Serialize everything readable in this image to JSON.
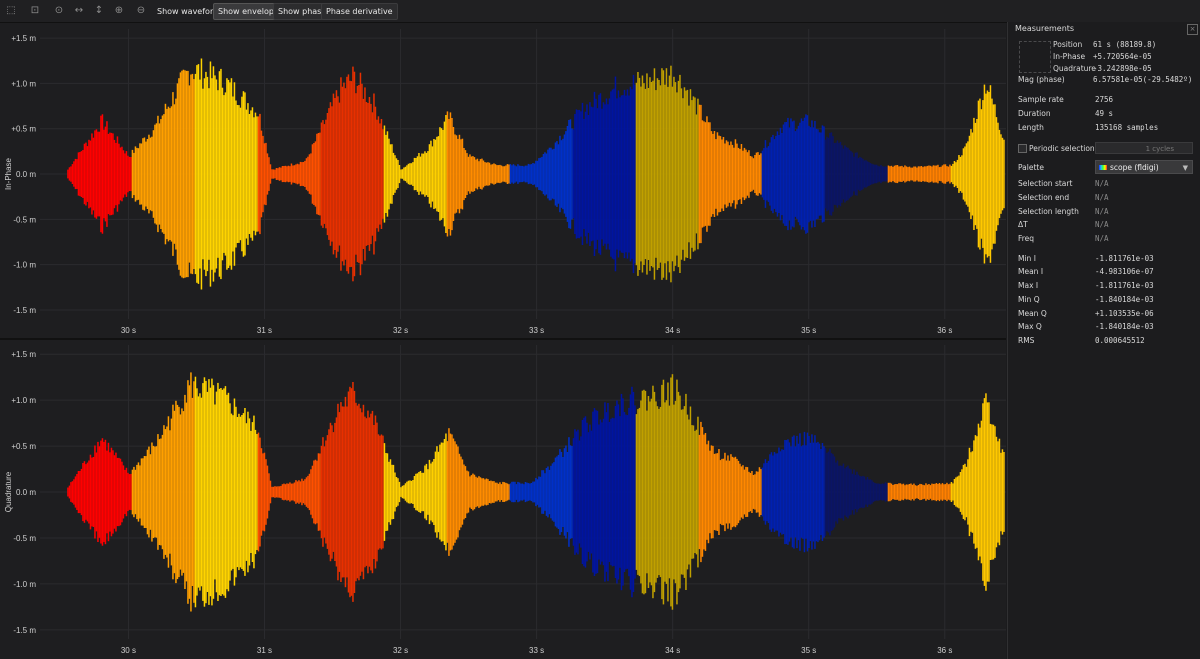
{
  "toolbar": {
    "tools": [
      "select-tool-icon",
      "zoom-box-icon",
      "zoom-fit-icon",
      "pan-horizontal-icon",
      "pan-vertical-icon",
      "zoom-in-icon",
      "zoom-out-icon"
    ],
    "show_waveform": "Show waveform",
    "show_envelope": "Show envelope",
    "show_phase": "Show phase",
    "phase_derivative": "Phase derivative"
  },
  "plots": [
    {
      "ylabel": "In-Phase"
    },
    {
      "ylabel": "Quadrature"
    }
  ],
  "axes": {
    "yticks": [
      "+1.5 m",
      "+1.0 m",
      "+0.5 m",
      "0.0 m",
      "-0.5 m",
      "-1.0 m",
      "-1.5 m"
    ],
    "xticks": [
      "30 s",
      "31 s",
      "32 s",
      "33 s",
      "34 s",
      "35 s",
      "36 s"
    ]
  },
  "chart_data": [
    {
      "type": "area",
      "title": "",
      "ylabel": "In-Phase",
      "x": [
        29.55,
        29.8,
        30.0,
        30.2,
        30.45,
        30.7,
        30.95,
        31.05,
        31.3,
        31.55,
        31.65,
        31.8,
        32.0,
        32.2,
        32.35,
        32.5,
        32.7,
        32.95,
        33.1,
        33.35,
        33.6,
        33.8,
        34.0,
        34.1,
        34.3,
        34.45,
        34.6,
        34.8,
        35.0,
        35.3,
        35.5,
        35.8,
        36.05,
        36.15,
        36.3,
        36.5
      ],
      "ylim": [
        -1.6,
        1.6
      ],
      "x_unit": "s",
      "y_unit": "m",
      "amplitude": [
        0.05,
        0.6,
        0.2,
        0.55,
        1.2,
        1.05,
        0.7,
        0.05,
        0.15,
        0.95,
        1.1,
        0.8,
        0.05,
        0.3,
        0.65,
        0.2,
        0.1,
        0.1,
        0.3,
        0.75,
        1.0,
        1.05,
        1.15,
        0.95,
        0.45,
        0.35,
        0.2,
        0.55,
        0.6,
        0.25,
        0.1,
        0.08,
        0.1,
        0.3,
        1.05,
        0.05
      ],
      "phase_colors": [
        "#ff0000",
        "#ffa000",
        "#ffd400",
        "#ff5000",
        "#e83000",
        "#ffd000",
        "#ff8c00",
        "#0030c8",
        "#0014a0",
        "#c0a000",
        "#ff8800",
        "#0020b0",
        "#0a1466",
        "#ff8000",
        "#ffc800"
      ]
    },
    {
      "type": "area",
      "title": "",
      "ylabel": "Quadrature",
      "x": [
        29.55,
        29.8,
        30.0,
        30.2,
        30.45,
        30.7,
        30.95,
        31.05,
        31.3,
        31.55,
        31.65,
        31.8,
        32.0,
        32.2,
        32.35,
        32.5,
        32.7,
        32.95,
        33.1,
        33.35,
        33.6,
        33.8,
        34.0,
        34.1,
        34.3,
        34.45,
        34.6,
        34.8,
        35.0,
        35.3,
        35.5,
        35.8,
        36.05,
        36.15,
        36.3,
        36.5
      ],
      "ylim": [
        -1.6,
        1.6
      ],
      "x_unit": "s",
      "y_unit": "m",
      "amplitude": [
        0.05,
        0.6,
        0.2,
        0.55,
        1.2,
        1.05,
        0.7,
        0.05,
        0.15,
        0.95,
        1.1,
        0.8,
        0.05,
        0.3,
        0.65,
        0.2,
        0.1,
        0.1,
        0.3,
        0.75,
        1.0,
        1.05,
        1.15,
        0.95,
        0.45,
        0.35,
        0.2,
        0.55,
        0.6,
        0.25,
        0.1,
        0.08,
        0.1,
        0.3,
        1.05,
        0.05
      ],
      "phase_colors": [
        "#ff0000",
        "#ffa000",
        "#ffd400",
        "#ff5000",
        "#e83000",
        "#ffd000",
        "#ff8c00",
        "#0030c8",
        "#0014a0",
        "#c0a000",
        "#ff8800",
        "#0020b0",
        "#0a1466",
        "#ff8000",
        "#ffc800"
      ]
    }
  ],
  "sidebar": {
    "title": "Measurements",
    "position_label": "Position",
    "position_value": "61 s (88189.8)",
    "inphase_label": "In-Phase",
    "inphase_value": "+5.720564e-05",
    "quadrature_label": "Quadrature",
    "quadrature_value": "-3.242898e-05",
    "mag_label": "Mag (phase)",
    "mag_value": "6.57581e-05(-29.5482º)",
    "sample_rate_label": "Sample rate",
    "sample_rate_value": "2756",
    "duration_label": "Duration",
    "duration_value": "49 s",
    "length_label": "Length",
    "length_value": "135168 samples",
    "periodic_label": "Periodic selection",
    "cycles_value": "1 cycles",
    "palette_label": "Palette",
    "palette_value": "scope (fldigi)",
    "sel_start_label": "Selection start",
    "sel_start_value": "N/A",
    "sel_end_label": "Selection end",
    "sel_end_value": "N/A",
    "sel_len_label": "Selection length",
    "sel_len_value": "N/A",
    "dt_label": "ΔT",
    "dt_value": "N/A",
    "freq_label": "Freq",
    "freq_value": "N/A",
    "min_i_label": "Min I",
    "min_i_value": "-1.811761e-03",
    "mean_i_label": "Mean I",
    "mean_i_value": "-4.983106e-07",
    "max_i_label": "Max I",
    "max_i_value": "-1.811761e-03",
    "min_q_label": "Min Q",
    "min_q_value": "-1.840184e-03",
    "mean_q_label": "Mean Q",
    "mean_q_value": "+1.103535e-06",
    "max_q_label": "Max Q",
    "max_q_value": "-1.840184e-03",
    "rms_label": "RMS",
    "rms_value": "0.000645512"
  }
}
